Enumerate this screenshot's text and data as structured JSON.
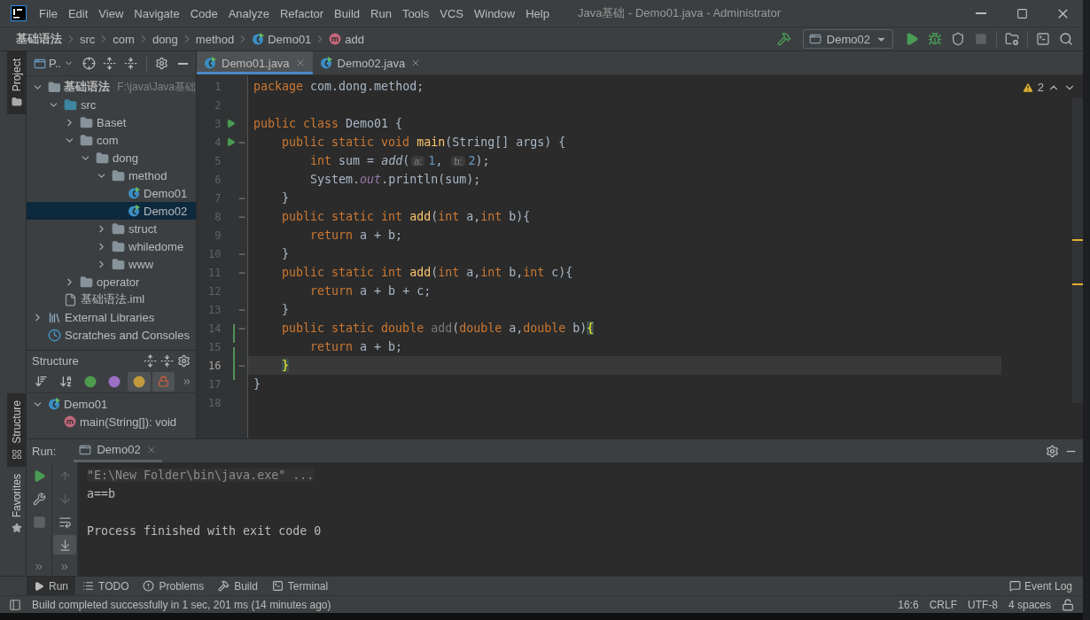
{
  "window": {
    "title": "Java基础 - Demo01.java - Administrator"
  },
  "menu": [
    "File",
    "Edit",
    "View",
    "Navigate",
    "Code",
    "Analyze",
    "Refactor",
    "Build",
    "Run",
    "Tools",
    "VCS",
    "Window",
    "Help"
  ],
  "breadcrumbs": [
    {
      "label": "基础语法",
      "kind": "module"
    },
    {
      "label": "src",
      "kind": "plain"
    },
    {
      "label": "com",
      "kind": "plain"
    },
    {
      "label": "dong",
      "kind": "plain"
    },
    {
      "label": "method",
      "kind": "plain"
    },
    {
      "label": "Demo01",
      "kind": "class"
    },
    {
      "label": "add",
      "kind": "method"
    }
  ],
  "run_config": {
    "label": "Demo02"
  },
  "toolbar": [
    {
      "kind": "run",
      "disabled": false
    },
    {
      "kind": "debug",
      "disabled": false
    },
    {
      "kind": "coverage",
      "disabled": false
    },
    {
      "kind": "stop",
      "disabled": true
    }
  ],
  "side_tabs": [
    {
      "label": "Project",
      "kind": "top",
      "selected": true
    },
    {
      "label": "Structure",
      "kind": "bottom",
      "selected": true
    },
    {
      "label": "Favorites",
      "kind": "bottom",
      "selected": false
    }
  ],
  "project_panel": {
    "title": "P..",
    "tree": [
      {
        "label": "基础语法",
        "kind": "module",
        "path": "F:\\java\\Java基础",
        "expanded": true,
        "selected": false,
        "children": [
          {
            "label": "src",
            "kind": "src",
            "expanded": true,
            "selected": false,
            "children": [
              {
                "label": "Baset",
                "kind": "package",
                "expanded": false,
                "selected": false
              },
              {
                "label": "com",
                "kind": "package",
                "expanded": true,
                "selected": false,
                "children": [
                  {
                    "label": "dong",
                    "kind": "package",
                    "expanded": true,
                    "selected": false,
                    "children": [
                      {
                        "label": "method",
                        "kind": "package",
                        "expanded": true,
                        "selected": false,
                        "children": [
                          {
                            "label": "Demo01",
                            "kind": "class",
                            "selected": false
                          },
                          {
                            "label": "Demo02",
                            "kind": "class",
                            "selected": true
                          }
                        ]
                      },
                      {
                        "label": "struct",
                        "kind": "package",
                        "expanded": false,
                        "selected": false
                      },
                      {
                        "label": "whiledome",
                        "kind": "package",
                        "expanded": false,
                        "selected": false
                      },
                      {
                        "label": "www",
                        "kind": "package",
                        "expanded": false,
                        "selected": false
                      }
                    ]
                  }
                ]
              },
              {
                "label": "operator",
                "kind": "package",
                "expanded": false,
                "selected": false
              }
            ]
          },
          {
            "label": "基础语法.iml",
            "kind": "iml",
            "selected": false
          }
        ]
      },
      {
        "label": "External Libraries",
        "kind": "libraries",
        "expanded": false,
        "selected": false
      },
      {
        "label": "Scratches and Consoles",
        "kind": "scratches",
        "selected": false
      }
    ]
  },
  "structure_panel": {
    "title": "Structure",
    "filters": [
      {
        "kind": "sort-visibility",
        "on": false
      },
      {
        "kind": "sort-alpha",
        "on": false
      },
      {
        "kind": "inherited",
        "on": false
      },
      {
        "kind": "properties",
        "on": false
      },
      {
        "kind": "fields",
        "on": true
      },
      {
        "kind": "non-public",
        "on": true
      }
    ],
    "tree": [
      {
        "label": "Demo01",
        "kind": "class",
        "expanded": true,
        "selected": false,
        "children": [
          {
            "label": "main(String[]): void",
            "kind": "method",
            "selected": false
          }
        ]
      }
    ]
  },
  "editor_tabs": [
    {
      "label": "Demo01.java",
      "selected": true
    },
    {
      "label": "Demo02.java",
      "selected": false
    }
  ],
  "inspection": {
    "count": "2"
  },
  "code": [
    {
      "number": "1",
      "tokens": [
        {
          "kind": "kw",
          "text": "package"
        },
        {
          "kind": "plain",
          "text": " com.dong.method;"
        }
      ]
    },
    {
      "number": "2"
    },
    {
      "number": "3",
      "run": true,
      "tokens": [
        {
          "kind": "kw",
          "text": "public class "
        },
        {
          "kind": "plain",
          "text": "Demo01 {"
        }
      ]
    },
    {
      "number": "4",
      "run": true,
      "fold": true,
      "tokens": [
        {
          "kind": "kw",
          "text": "    public static void "
        },
        {
          "kind": "decl",
          "text": "main"
        },
        {
          "kind": "plain",
          "text": "(String[] args) {"
        }
      ]
    },
    {
      "number": "5",
      "tokens": [
        {
          "kind": "kw",
          "text": "        int "
        },
        {
          "kind": "plain",
          "text": "sum = "
        },
        {
          "kind": "call",
          "text": "add"
        },
        {
          "kind": "plain",
          "text": "("
        },
        {
          "kind": "hint",
          "text": "a:"
        },
        {
          "kind": "num",
          "text": "1"
        },
        {
          "kind": "plain",
          "text": ", "
        },
        {
          "kind": "hint",
          "text": "b:"
        },
        {
          "kind": "num",
          "text": "2"
        },
        {
          "kind": "plain",
          "text": ");"
        }
      ]
    },
    {
      "number": "6",
      "tokens": [
        {
          "kind": "plain",
          "text": "        System."
        },
        {
          "kind": "field",
          "text": "out"
        },
        {
          "kind": "plain",
          "text": ".println(sum);"
        }
      ]
    },
    {
      "number": "7",
      "fold": true,
      "tokens": [
        {
          "kind": "plain",
          "text": "    }"
        }
      ]
    },
    {
      "number": "8",
      "fold": true,
      "tokens": [
        {
          "kind": "kw",
          "text": "    public static int "
        },
        {
          "kind": "decl",
          "text": "add"
        },
        {
          "kind": "plain",
          "text": "("
        },
        {
          "kind": "kw",
          "text": "int "
        },
        {
          "kind": "plain",
          "text": "a,"
        },
        {
          "kind": "kw",
          "text": "int "
        },
        {
          "kind": "plain",
          "text": "b){"
        }
      ]
    },
    {
      "number": "9",
      "tokens": [
        {
          "kind": "kw",
          "text": "        return "
        },
        {
          "kind": "plain",
          "text": "a + b;"
        }
      ]
    },
    {
      "number": "10",
      "fold": true,
      "tokens": [
        {
          "kind": "plain",
          "text": "    }"
        }
      ]
    },
    {
      "number": "11",
      "fold": true,
      "tokens": [
        {
          "kind": "kw",
          "text": "    public static int "
        },
        {
          "kind": "decl",
          "text": "add"
        },
        {
          "kind": "plain",
          "text": "("
        },
        {
          "kind": "kw",
          "text": "int "
        },
        {
          "kind": "plain",
          "text": "a,"
        },
        {
          "kind": "kw",
          "text": "int "
        },
        {
          "kind": "plain",
          "text": "b,"
        },
        {
          "kind": "kw",
          "text": "int "
        },
        {
          "kind": "plain",
          "text": "c){"
        }
      ]
    },
    {
      "number": "12",
      "tokens": [
        {
          "kind": "kw",
          "text": "        return "
        },
        {
          "kind": "plain",
          "text": "a + b + c;"
        }
      ]
    },
    {
      "number": "13",
      "fold": true,
      "tokens": [
        {
          "kind": "plain",
          "text": "    }"
        }
      ]
    },
    {
      "number": "14",
      "fold": true,
      "changed": true,
      "tokens": [
        {
          "kind": "kw",
          "text": "    public static double "
        },
        {
          "kind": "unused",
          "text": "add"
        },
        {
          "kind": "plain",
          "text": "("
        },
        {
          "kind": "kw",
          "text": "double "
        },
        {
          "kind": "plain",
          "text": "a,"
        },
        {
          "kind": "kw",
          "text": "double "
        },
        {
          "kind": "plain",
          "text": "b)"
        },
        {
          "kind": "match",
          "text": "{"
        }
      ]
    },
    {
      "number": "15",
      "changed": true,
      "tokens": [
        {
          "kind": "kw",
          "text": "        return "
        },
        {
          "kind": "plain",
          "text": "a + b;"
        }
      ]
    },
    {
      "number": "16",
      "fold": true,
      "changed": true,
      "current": true,
      "tokens": [
        {
          "kind": "match",
          "text": "    }"
        }
      ]
    },
    {
      "number": "17",
      "tokens": [
        {
          "kind": "plain",
          "text": "}"
        }
      ]
    },
    {
      "number": "18"
    }
  ],
  "run_panel": {
    "label": "Run:",
    "tabs": [
      {
        "label": "Demo02",
        "selected": true
      }
    ],
    "left_tools": [
      {
        "kind": "rerun",
        "disabled": false
      },
      {
        "kind": "settings",
        "disabled": false
      },
      {
        "kind": "stop",
        "disabled": true
      }
    ],
    "right_tools": [
      {
        "kind": "up",
        "disabled": true
      },
      {
        "kind": "down",
        "disabled": true
      },
      {
        "kind": "soft-wrap",
        "disabled": false,
        "on": false
      },
      {
        "kind": "scroll-to-end",
        "disabled": false,
        "on": true
      }
    ],
    "console": [
      {
        "kind": "command",
        "text": "\"E:\\New Folder\\bin\\java.exe\" ..."
      },
      {
        "kind": "output",
        "text": "a==b"
      },
      {
        "kind": "blank"
      },
      {
        "kind": "output",
        "text": "Process finished with exit code 0"
      }
    ]
  },
  "tool_tabs": [
    {
      "label": "Run",
      "kind": "run",
      "selected": true
    },
    {
      "label": "TODO",
      "kind": "todo",
      "selected": false
    },
    {
      "label": "Problems",
      "kind": "problems",
      "selected": false
    },
    {
      "label": "Build",
      "kind": "build",
      "selected": false
    },
    {
      "label": "Terminal",
      "kind": "terminal",
      "selected": false
    }
  ],
  "event_log": "Event Log",
  "status_bar": {
    "message": "Build completed successfully in 1 sec, 201 ms (14 minutes ago)",
    "items": [
      "16:6",
      "CRLF",
      "UTF-8",
      "4 spaces"
    ]
  }
}
